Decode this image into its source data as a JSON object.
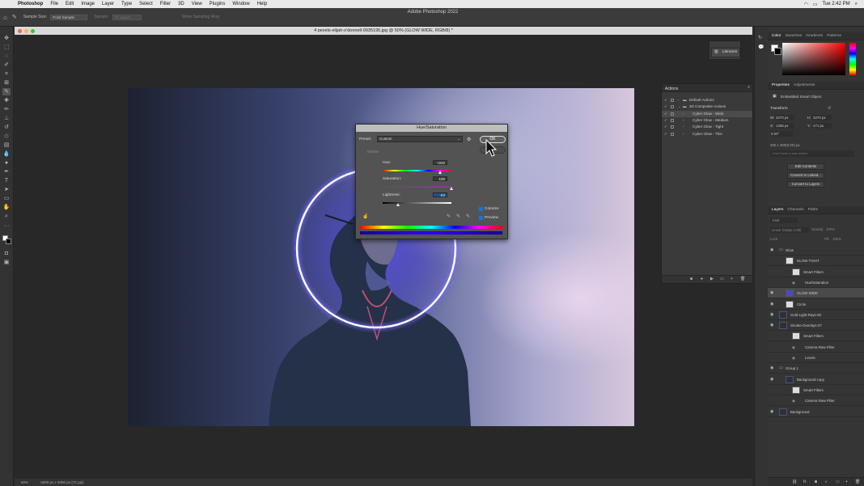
{
  "menubar": {
    "app": "Photoshop",
    "items": [
      "File",
      "Edit",
      "Image",
      "Layer",
      "Type",
      "Select",
      "Filter",
      "3D",
      "View",
      "Plugins",
      "Window",
      "Help"
    ],
    "clock": "Tue 2:42 PM"
  },
  "app_title": "Adobe Photoshop 2022",
  "options_bar": {
    "sample_size_label": "Sample Size:",
    "sample_size_value": "Point Sample",
    "sample_label": "Sample:",
    "sample_value": "All Layers",
    "show_ring": "Show Sampling Ring"
  },
  "document": {
    "tab_title": "4 pexels-elijah-o'donnell-9935195.jpg @ 50% (GLOW WIDE, RGB/8) *",
    "zoom": "50%",
    "size": "6000 px x 4000 px (72 ppi)"
  },
  "hue_saturation": {
    "title": "Hue/Saturation",
    "preset_label": "Preset:",
    "preset_value": "Custom",
    "ok_label": "OK",
    "master": "Master",
    "hue_label": "Hue:",
    "hue_value": "+242",
    "saturation_label": "Saturation:",
    "saturation_value": "100",
    "lightness_label": "Lightness:",
    "lightness_value": "-53",
    "colorize_label": "Colorize",
    "preview_label": "Preview",
    "hue_position": 0.836,
    "saturation_position": 1.0,
    "lightness_position": 0.235
  },
  "libraries_label": "Libraries",
  "actions": {
    "title": "Actions",
    "rows": [
      {
        "name": "Default Actions",
        "level": 0,
        "selected": false
      },
      {
        "name": "4D Composite Actions",
        "level": 0,
        "selected": false
      },
      {
        "name": "Cyber Glow - Wide",
        "level": 1,
        "selected": true
      },
      {
        "name": "Cyber Glow - Medium",
        "level": 1,
        "selected": false
      },
      {
        "name": "Cyber Glow - Tight",
        "level": 1,
        "selected": false
      },
      {
        "name": "Cyber Glow - Thin",
        "level": 1,
        "selected": false
      }
    ]
  },
  "color_tabs": [
    "Color",
    "Swatches",
    "Gradients",
    "Patterns"
  ],
  "properties": {
    "tabs": [
      "Properties",
      "Adjustments"
    ],
    "type": "Embedded Smart Object",
    "transform_label": "Transform",
    "w_label": "W:",
    "w_value": "3270 px",
    "h_label": "H:",
    "h_value": "3270 px",
    "x_label": "X:",
    "x_value": "1265 px",
    "y_label": "Y:",
    "y_value": "271 px",
    "angle_value": "0.00°",
    "size_text": "300 x 300(0.00) px",
    "no_linked": "Don't have a auto-linked",
    "edit_contents": "Edit Contents",
    "convert_linked": "Convert to Linked...",
    "convert_layers": "Convert to Layers"
  },
  "layers": {
    "tabs": [
      "Layers",
      "Channels",
      "Paths"
    ],
    "search_placeholder": "Kind",
    "blend_mode": "Linear Dodge (Add)",
    "opacity_label": "Opacity:",
    "opacity_value": "100%",
    "lock_label": "Lock:",
    "fill_label": "Fill:",
    "fill_value": "100%",
    "rows": [
      {
        "name": "Glow",
        "indent": 0,
        "kind": "group",
        "eye": true
      },
      {
        "name": "GLOW TIGHT",
        "indent": 1,
        "kind": "layer",
        "eye": false
      },
      {
        "name": "Smart Filters",
        "indent": 2,
        "kind": "filter",
        "eye": false
      },
      {
        "name": "Hue/Saturation",
        "indent": 3,
        "kind": "filter-item",
        "eye": false
      },
      {
        "name": "GLOW WIDE",
        "indent": 1,
        "kind": "layer",
        "eye": true,
        "selected": true
      },
      {
        "name": "Circle",
        "indent": 1,
        "kind": "layer",
        "eye": true
      },
      {
        "name": "Gold-Light-Rays-60",
        "indent": 0,
        "kind": "layer",
        "eye": true
      },
      {
        "name": "Smoke-Overlays-37",
        "indent": 0,
        "kind": "layer",
        "eye": true
      },
      {
        "name": "Smart Filters",
        "indent": 2,
        "kind": "filter",
        "eye": false
      },
      {
        "name": "Camera Raw Filter",
        "indent": 3,
        "kind": "filter-item",
        "eye": false
      },
      {
        "name": "Levels",
        "indent": 3,
        "kind": "filter-item",
        "eye": false
      },
      {
        "name": "Group 1",
        "indent": 0,
        "kind": "group",
        "eye": true
      },
      {
        "name": "Background copy",
        "indent": 1,
        "kind": "layer",
        "eye": true
      },
      {
        "name": "Smart Filters",
        "indent": 2,
        "kind": "filter",
        "eye": false
      },
      {
        "name": "Camera Raw Filter",
        "indent": 3,
        "kind": "filter-item",
        "eye": false
      },
      {
        "name": "Background",
        "indent": 0,
        "kind": "layer",
        "eye": true
      }
    ]
  },
  "colors": {
    "accent": "#1473e6",
    "ring_glow": "#4b3dff"
  }
}
